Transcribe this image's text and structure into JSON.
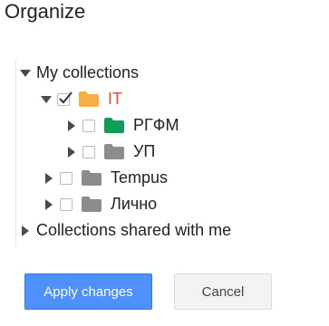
{
  "dialog": {
    "title": "Organize"
  },
  "tree": {
    "my_collections": {
      "label": "My collections",
      "items": [
        {
          "label": "IT",
          "checked": true,
          "expanded": true,
          "folder_color": "#f6ae45",
          "label_color": "#dd4b39",
          "children": [
            {
              "label": "РГФМ",
              "checked": false,
              "expanded": false,
              "folder_color": "#0f9d58"
            },
            {
              "label": "УП",
              "checked": false,
              "expanded": false,
              "folder_color": "#8c8c8c"
            }
          ]
        },
        {
          "label": "Tempus",
          "checked": false,
          "expanded": false,
          "folder_color": "#8c8c8c"
        },
        {
          "label": "Лично",
          "checked": false,
          "expanded": false,
          "folder_color": "#8c8c8c"
        }
      ]
    },
    "shared": {
      "label": "Collections shared with me"
    }
  },
  "buttons": {
    "apply_label": "Apply changes",
    "cancel_label": "Cancel"
  },
  "colors": {
    "accent": "#4d90fe",
    "selected_text": "#dd4b39"
  }
}
